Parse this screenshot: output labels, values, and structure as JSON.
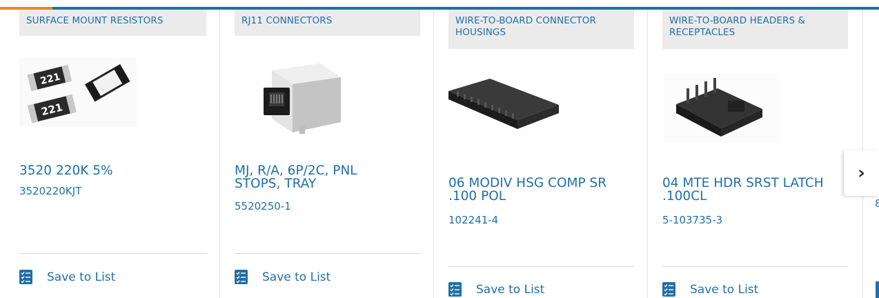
{
  "colors": {
    "accent_blue": "#1f6fa8",
    "accent_orange": "#e8891d",
    "category_bg": "#ebebeb"
  },
  "save_label": "Save to List",
  "next_label": "›",
  "peek_text": "8",
  "products": [
    {
      "category": "SURFACE MOUNT RESISTORS",
      "title": "3520 220K 5%",
      "part_number": "3520220KJT",
      "image": "resistor-image"
    },
    {
      "category": "RJ11 CONNECTORS",
      "title": "MJ, R/A, 6P/2C, PNL STOPS, TRAY",
      "part_number": "5520250-1",
      "image": "rj11-connector-image"
    },
    {
      "category": "WIRE-TO-BOARD CONNECTOR HOUSINGS",
      "title": "06 MODIV HSG COMP SR .100 POL",
      "part_number": "102241-4",
      "image": "connector-housing-image"
    },
    {
      "category": "WIRE-TO-BOARD HEADERS & RECEPTACLES",
      "title": "04 MTE HDR SRST LATCH .100CL",
      "part_number": "5-103735-3",
      "image": "header-image"
    }
  ]
}
